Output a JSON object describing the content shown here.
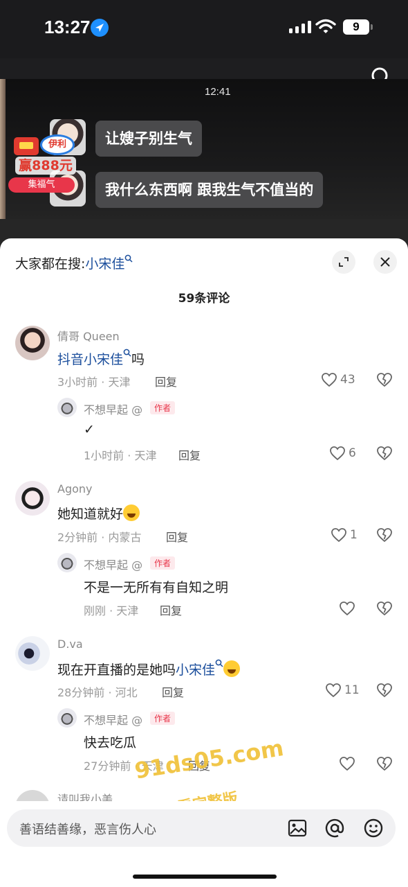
{
  "status_bar": {
    "time": "13:27",
    "battery": "9"
  },
  "video": {
    "clock": "12:41",
    "messages": [
      "让嫂子别生气",
      "我什么东西啊 跟我生气不值当的"
    ],
    "promo": {
      "brand": "伊利",
      "amount": "赢888元",
      "label": "集福气"
    }
  },
  "sheet": {
    "trending_label": "大家都在搜:",
    "trending_keyword": "小宋佳",
    "comment_count": "59条评论"
  },
  "comments": [
    {
      "author": "倩哥 Queen",
      "text_prefix": "抖音",
      "keyword": "小宋佳",
      "text_suffix": "吗",
      "meta": "3小时前 · 天津",
      "reply_label": "回复",
      "likes": "43",
      "reply": {
        "author": "不想早起",
        "tag": "作者",
        "text": "✓",
        "meta": "1小时前 · 天津",
        "reply_label": "回复",
        "likes": "6"
      }
    },
    {
      "author": "Agony",
      "text": "她知道就好",
      "meta": "2分钟前 · 内蒙古",
      "reply_label": "回复",
      "likes": "1",
      "reply": {
        "author": "不想早起",
        "tag": "作者",
        "text": "不是一无所有有自知之明",
        "meta": "刚刚 · 天津",
        "reply_label": "回复",
        "likes": ""
      }
    },
    {
      "author": "D.va",
      "text_prefix": "现在开直播的是她吗",
      "keyword": "小宋佳",
      "meta": "28分钟前 · 河北",
      "reply_label": "回复",
      "likes": "11",
      "reply": {
        "author": "不想早起",
        "tag": "作者",
        "text": "快去吃瓜",
        "meta": "27分钟前 · 天津",
        "reply_label": "回复",
        "likes": ""
      }
    },
    {
      "author": "请叫我小美"
    }
  ],
  "watermark": {
    "url": "91ds05.com",
    "text": "看完整版"
  },
  "input": {
    "placeholder": "善语结善缘，恶言伤人心"
  },
  "colors": {
    "keyword": "#1b4e9c",
    "author_tag": "#e8364a",
    "watermark": "#f0c23a"
  },
  "icons": [
    "location-arrow-icon",
    "signal-icon",
    "wifi-icon",
    "search-icon",
    "expand-icon",
    "close-icon",
    "heart-icon",
    "broken-heart-icon",
    "search-mini-icon",
    "image-icon",
    "at-icon",
    "emoji-icon"
  ]
}
